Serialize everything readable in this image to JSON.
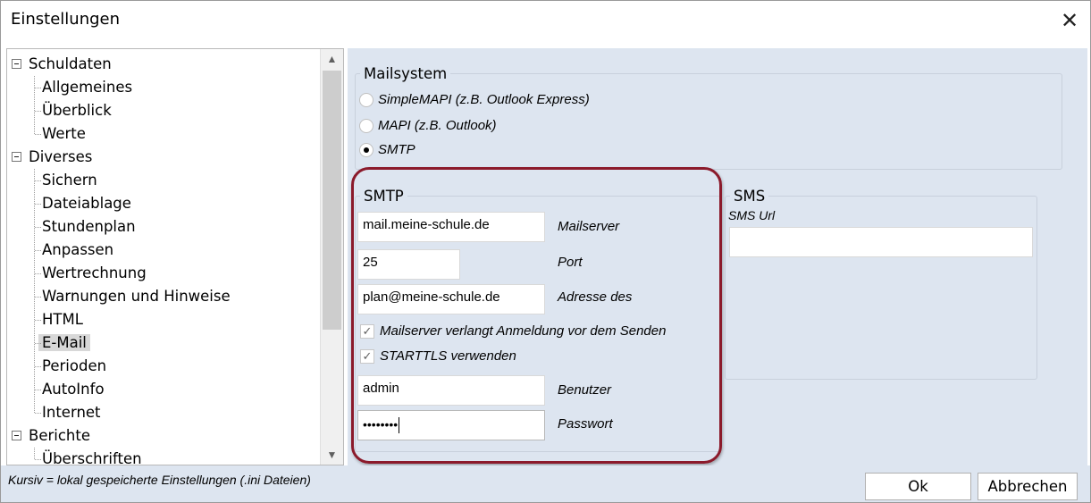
{
  "window": {
    "title": "Einstellungen",
    "close_glyph": "✕"
  },
  "tree": {
    "nodes": [
      {
        "label": "Schuldaten",
        "level": 0
      },
      {
        "label": "Allgemeines",
        "level": 1
      },
      {
        "label": "Überblick",
        "level": 1
      },
      {
        "label": "Werte",
        "level": 1
      },
      {
        "label": "Diverses",
        "level": 0
      },
      {
        "label": "Sichern",
        "level": 1
      },
      {
        "label": "Dateiablage",
        "level": 1
      },
      {
        "label": "Stundenplan",
        "level": 1
      },
      {
        "label": "Anpassen",
        "level": 1
      },
      {
        "label": "Wertrechnung",
        "level": 1
      },
      {
        "label": "Warnungen und Hinweise",
        "level": 1
      },
      {
        "label": "HTML",
        "level": 1
      },
      {
        "label": "E-Mail",
        "level": 1,
        "selected": true
      },
      {
        "label": "Perioden",
        "level": 1
      },
      {
        "label": "AutoInfo",
        "level": 1
      },
      {
        "label": "Internet",
        "level": 1
      },
      {
        "label": "Berichte",
        "level": 0
      },
      {
        "label": "Überschriften",
        "level": 1
      }
    ]
  },
  "mailsystem": {
    "title": "Mailsystem",
    "options": [
      {
        "label": "SimpleMAPI (z.B. Outlook Express)",
        "checked": false
      },
      {
        "label": "MAPI (z.B. Outlook)",
        "checked": false
      },
      {
        "label": "SMTP",
        "checked": true
      }
    ]
  },
  "smtp": {
    "title": "SMTP",
    "mailserver": {
      "value": "mail.meine-schule.de",
      "label": "Mailserver"
    },
    "port": {
      "value": "25",
      "label": "Port"
    },
    "address": {
      "value": "plan@meine-schule.de",
      "label": "Adresse des"
    },
    "auth_required": {
      "label": "Mailserver verlangt Anmeldung vor dem Senden",
      "checked": true
    },
    "starttls": {
      "label": "STARTTLS verwenden",
      "checked": true
    },
    "user": {
      "value": "admin",
      "label": "Benutzer"
    },
    "password": {
      "value": "••••••••",
      "label": "Passwort"
    }
  },
  "sms": {
    "title": "SMS",
    "url_label": "SMS Url",
    "url_value": ""
  },
  "footer": {
    "note": "Kursiv = lokal gespeicherte Einstellungen (.ini Dateien)",
    "ok_label": "Ok",
    "cancel_label": "Abbrechen"
  },
  "colors": {
    "panel": "#dde5f0",
    "highlight": "#8b1a2b"
  }
}
